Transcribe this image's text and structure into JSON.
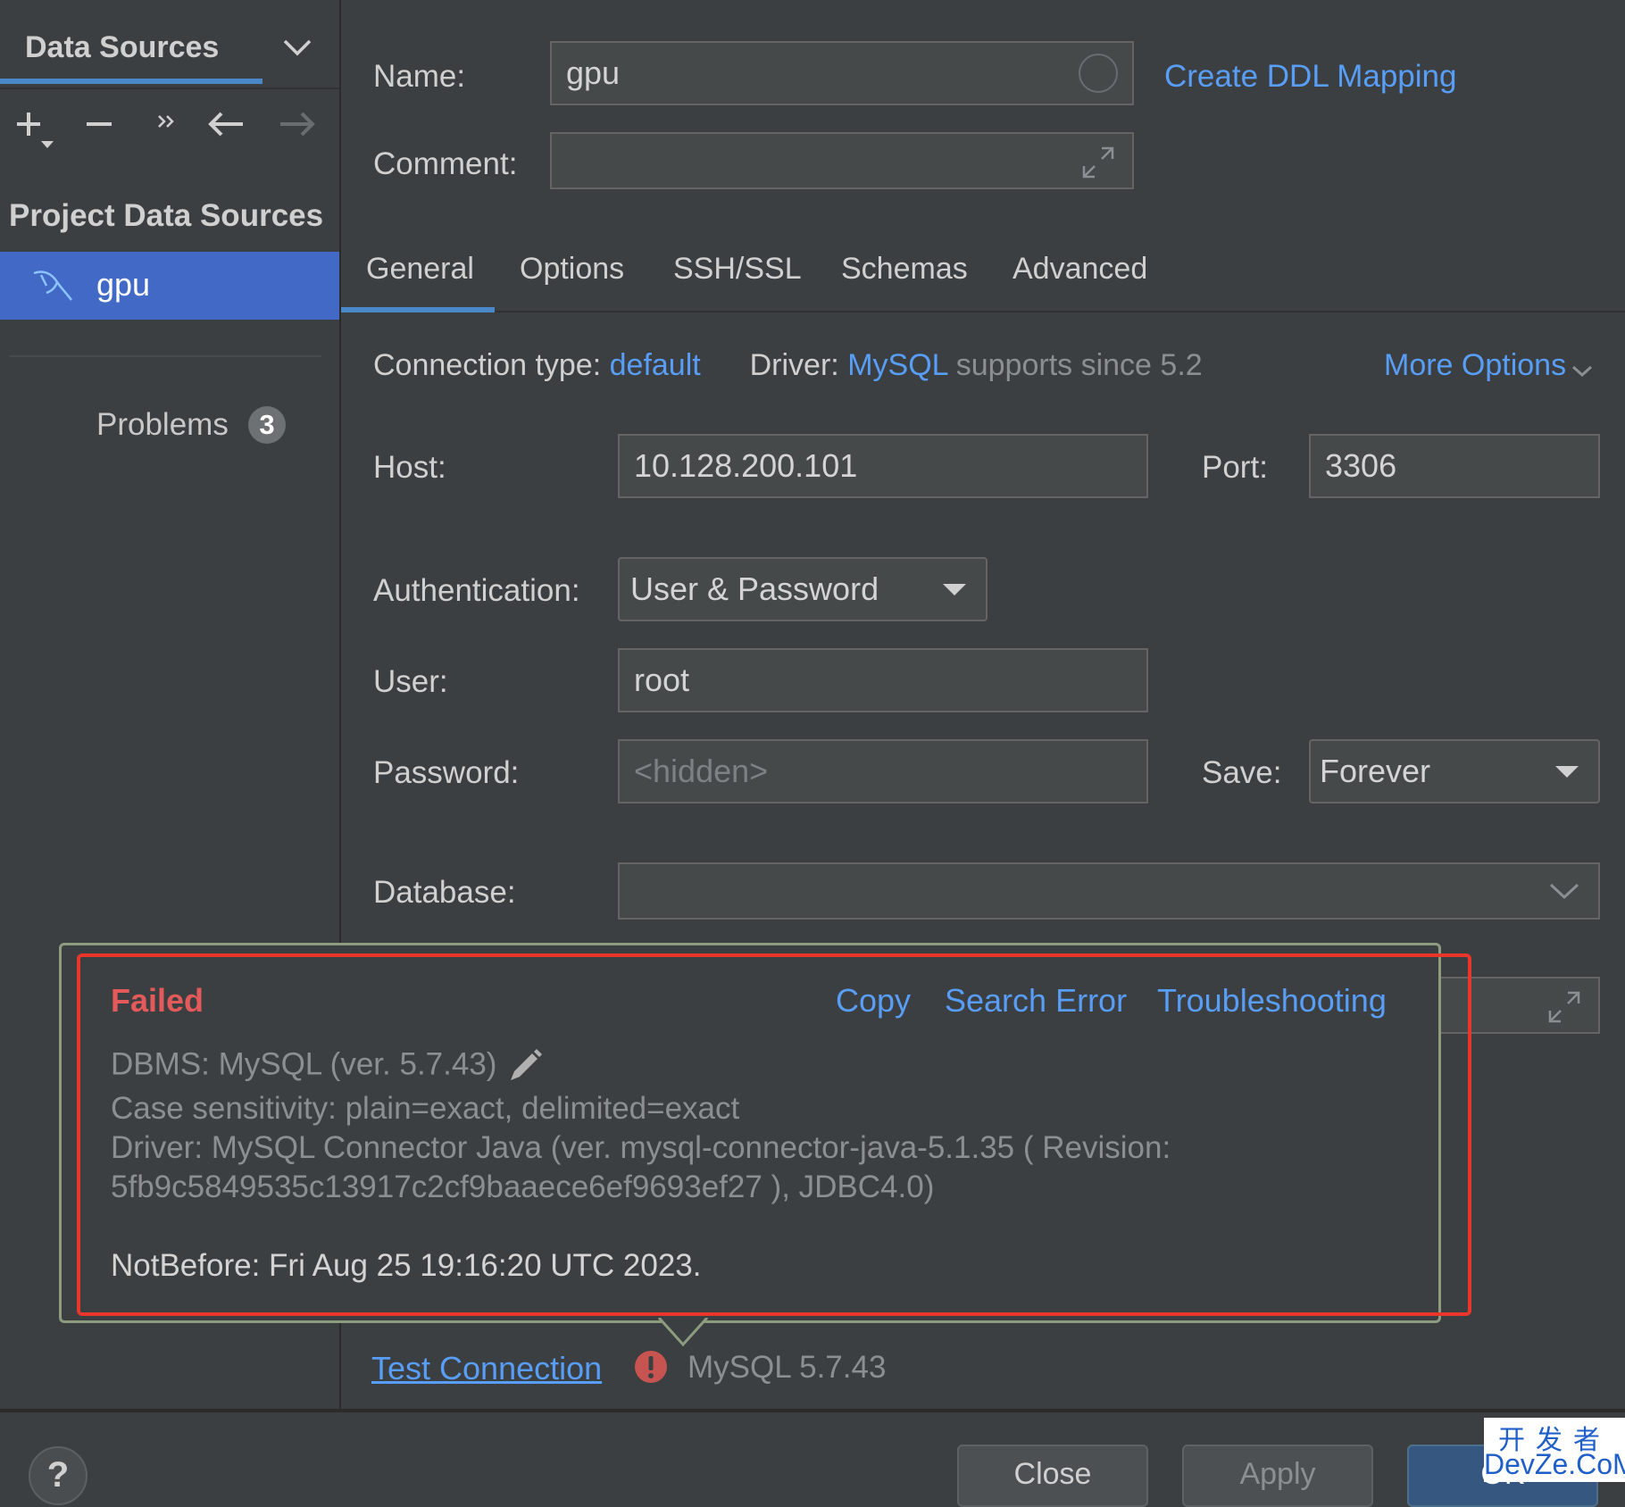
{
  "sidebar": {
    "title": "Data Sources",
    "section_title": "Project Data Sources",
    "selected_item": "gpu",
    "problems_label": "Problems",
    "problems_count": "3"
  },
  "form": {
    "name_label": "Name:",
    "name_value": "gpu",
    "create_ddl_link": "Create DDL Mapping",
    "comment_label": "Comment:",
    "comment_value": "",
    "tabs": [
      "General",
      "Options",
      "SSH/SSL",
      "Schemas",
      "Advanced"
    ],
    "active_tab": "General",
    "connection_type_label": "Connection type:",
    "connection_type_value": "default",
    "driver_label": "Driver:",
    "driver_value": "MySQL",
    "driver_note": "supports since 5.2",
    "more_options": "More Options",
    "host_label": "Host:",
    "host_value": "10.128.200.101",
    "port_label": "Port:",
    "port_value": "3306",
    "auth_label": "Authentication:",
    "auth_value": "User & Password",
    "user_label": "User:",
    "user_value": "root",
    "password_label": "Password:",
    "password_placeholder": "<hidden>",
    "save_label": "Save:",
    "save_value": "Forever",
    "database_label": "Database:",
    "database_value": ""
  },
  "popup": {
    "status": "Failed",
    "copy": "Copy",
    "search_error": "Search Error",
    "troubleshooting": "Troubleshooting",
    "dbms": "DBMS: MySQL (ver. 5.7.43)",
    "case_sensitivity": "Case sensitivity: plain=exact, delimited=exact",
    "driver_line1": "Driver: MySQL Connector Java (ver. mysql-connector-java-5.1.35 ( Revision:",
    "driver_line2": "5fb9c5849535c13917c2cf9baaece6ef9693ef27 ), JDBC4.0)",
    "notbefore": "NotBefore: Fri Aug 25 19:16:20 UTC 2023."
  },
  "bottom": {
    "test_connection": "Test Connection",
    "mysql_version": "MySQL 5.7.43",
    "help": "?",
    "close": "Close",
    "apply": "Apply",
    "ok": "OK"
  },
  "watermark": {
    "top": "开发者",
    "bottom": "DevZe.CoM"
  },
  "colors": {
    "background": "#3c3f41",
    "link": "#589df6",
    "selection": "#4269c5",
    "error": "#e45a5a",
    "highlight_border": "#e8362b"
  }
}
